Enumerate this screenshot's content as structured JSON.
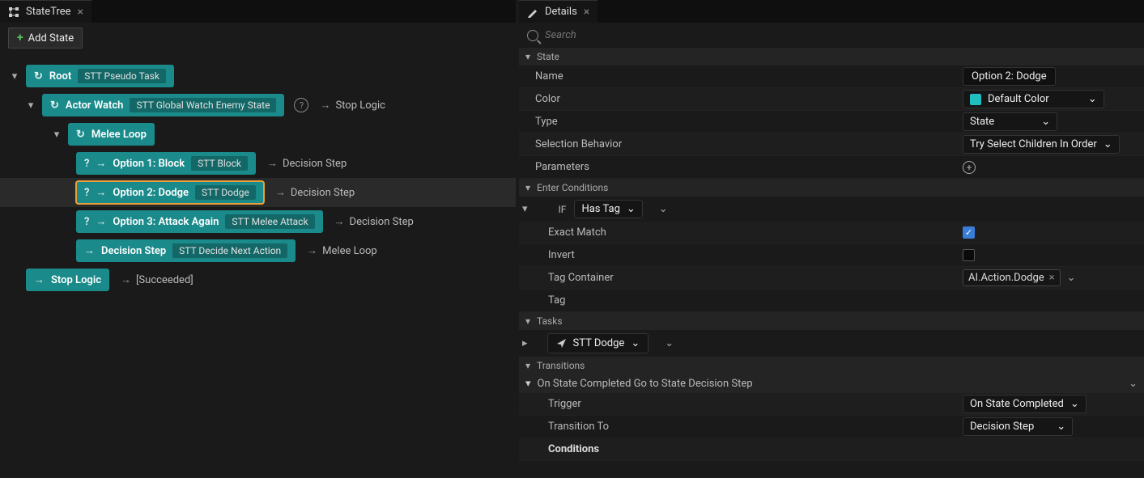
{
  "leftPanel": {
    "tabTitle": "StateTree",
    "addState": "Add State",
    "nodes": {
      "root": {
        "label": "Root",
        "task": "STT Pseudo Task"
      },
      "actorWatch": {
        "label": "Actor Watch",
        "task": "STT Global Watch Enemy State",
        "trans": "Stop Logic"
      },
      "meleeLoop": {
        "label": "Melee Loop"
      },
      "opt1": {
        "label": "Option 1: Block",
        "task": "STT Block",
        "trans": "Decision Step"
      },
      "opt2": {
        "label": "Option 2: Dodge",
        "task": "STT Dodge",
        "trans": "Decision Step"
      },
      "opt3": {
        "label": "Option 3: Attack Again",
        "task": "STT Melee Attack",
        "trans": "Decision Step"
      },
      "decision": {
        "label": "Decision Step",
        "task": "STT Decide Next Action",
        "trans": "Melee Loop"
      },
      "stopLogic": {
        "label": "Stop Logic",
        "trans": "[Succeeded]"
      }
    }
  },
  "rightPanel": {
    "tabTitle": "Details",
    "searchPlaceholder": "Search",
    "sections": {
      "state": "State",
      "enterConditions": "Enter Conditions",
      "tasks": "Tasks",
      "transitions": "Transitions"
    },
    "state": {
      "labels": {
        "name": "Name",
        "color": "Color",
        "type": "Type",
        "selBehavior": "Selection Behavior",
        "params": "Parameters"
      },
      "name": "Option 2: Dodge",
      "color": "Default Color",
      "type": "State",
      "selBehavior": "Try Select Children In Order"
    },
    "enter": {
      "if": "IF",
      "condition": "Has Tag",
      "labels": {
        "exactMatch": "Exact Match",
        "invert": "Invert",
        "tagContainer": "Tag Container",
        "tag": "Tag"
      },
      "exactMatch": true,
      "invert": false,
      "tagContainer": "AI.Action.Dodge"
    },
    "task": {
      "name": "STT Dodge"
    },
    "transition": {
      "title": "On State Completed Go to State Decision Step",
      "labels": {
        "trigger": "Trigger",
        "transitionTo": "Transition To",
        "conditions": "Conditions"
      },
      "trigger": "On State Completed",
      "transitionTo": "Decision Step"
    }
  }
}
